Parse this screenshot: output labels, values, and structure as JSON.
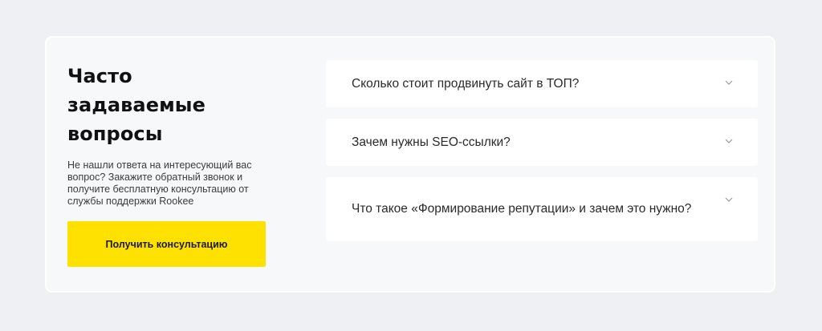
{
  "faq_section": {
    "title": "Часто задаваемые вопросы",
    "description": "Не нашли ответа на интересующий вас вопрос? Закажите обратный звонок и получите бесплатную консультацию от службы поддержки Rookee",
    "cta_label": "Получить консультацию",
    "accent_color": "#ffe100",
    "questions": [
      {
        "text": "Сколько стоит продвинуть сайт в ТОП?",
        "icon": "chevron-down-icon"
      },
      {
        "text": "Зачем нужны SEO-ссылки?",
        "icon": "chevron-down-icon"
      },
      {
        "text": "Что такое «Формирование репутации» и зачем это нужно?",
        "icon": "chevron-down-icon"
      }
    ]
  }
}
